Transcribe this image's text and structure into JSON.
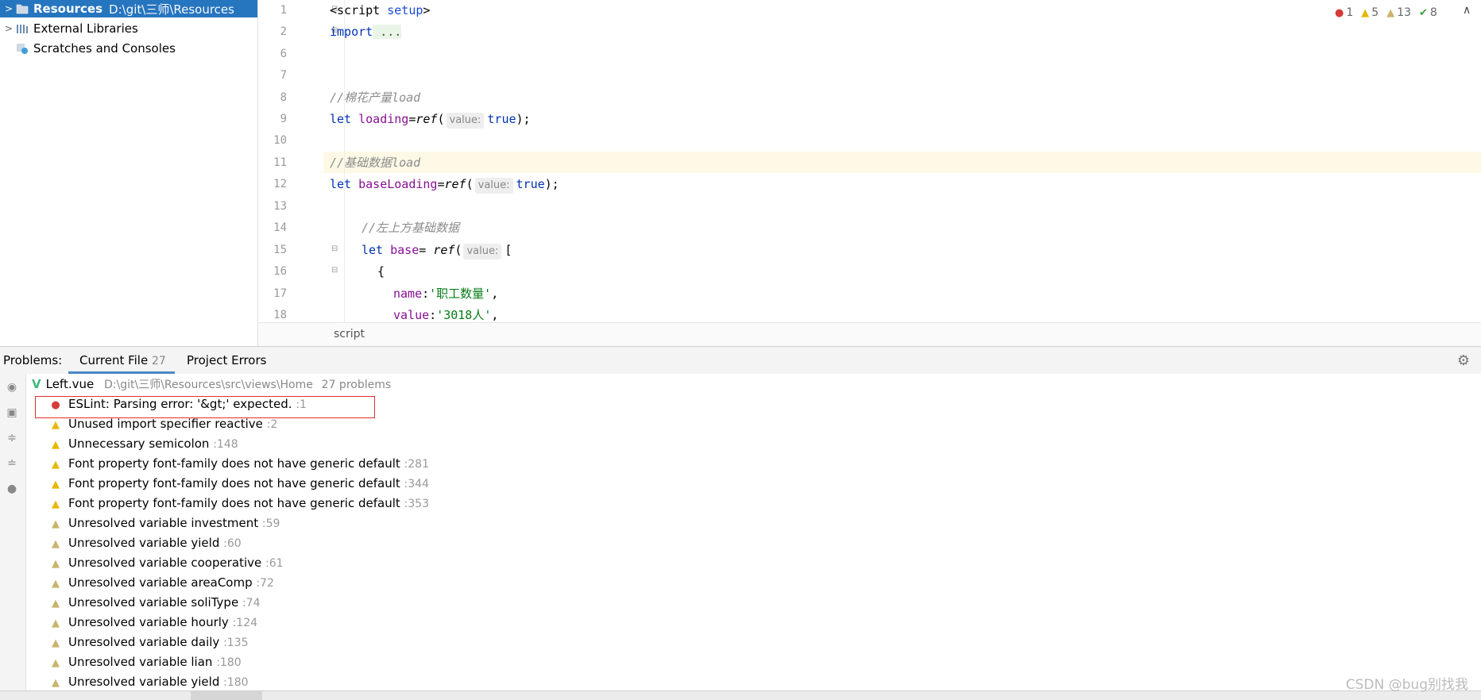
{
  "tree": {
    "items": [
      {
        "arrow": ">",
        "name": "Resources",
        "path": "D:\\git\\三师\\Resources",
        "selected": true
      },
      {
        "arrow": ">",
        "name": "External Libraries",
        "path": "",
        "selected": false
      },
      {
        "arrow": "",
        "name": "Scratches and Consoles",
        "path": "",
        "selected": false
      }
    ]
  },
  "editor": {
    "line_numbers": [
      "1",
      "2",
      "6",
      "7",
      "8",
      "9",
      "10",
      "11",
      "12",
      "13",
      "14",
      "15",
      "16",
      "17",
      "18"
    ],
    "inspections": {
      "errors": "1",
      "warnings": "5",
      "weak_warnings": "13",
      "typos": "8"
    },
    "breadcrumb": "script",
    "hint_label": "value:"
  },
  "problems": {
    "label": "Problems:",
    "tabs": [
      {
        "label": "Current File",
        "count": "27"
      },
      {
        "label": "Project Errors",
        "count": ""
      }
    ],
    "file": {
      "name": "Left.vue",
      "path": "D:\\git\\三师\\Resources\\src\\views\\Home",
      "count": "27 problems"
    },
    "items": [
      {
        "severity": "error",
        "text": "ESLint: Parsing error: '&gt;' expected.",
        "line": ":1"
      },
      {
        "severity": "warning",
        "text": "Unused import specifier reactive",
        "line": ":2"
      },
      {
        "severity": "warning",
        "text": "Unnecessary semicolon",
        "line": ":148"
      },
      {
        "severity": "warning",
        "text": "Font property font-family does not have generic default",
        "line": ":281"
      },
      {
        "severity": "warning",
        "text": "Font property font-family does not have generic default",
        "line": ":344"
      },
      {
        "severity": "warning",
        "text": "Font property font-family does not have generic default",
        "line": ":353"
      },
      {
        "severity": "weak",
        "text": "Unresolved variable investment",
        "line": ":59"
      },
      {
        "severity": "weak",
        "text": "Unresolved variable yield",
        "line": ":60"
      },
      {
        "severity": "weak",
        "text": "Unresolved variable cooperative",
        "line": ":61"
      },
      {
        "severity": "weak",
        "text": "Unresolved variable areaComp",
        "line": ":72"
      },
      {
        "severity": "weak",
        "text": "Unresolved variable soliType",
        "line": ":74"
      },
      {
        "severity": "weak",
        "text": "Unresolved variable hourly",
        "line": ":124"
      },
      {
        "severity": "weak",
        "text": "Unresolved variable daily",
        "line": ":135"
      },
      {
        "severity": "weak",
        "text": "Unresolved variable lian",
        "line": ":180"
      },
      {
        "severity": "weak",
        "text": "Unresolved variable yield",
        "line": ":180"
      }
    ]
  },
  "code": {
    "l1_tag_open": "<script",
    "l1_setup": " setup",
    "l1_tag_close": ">",
    "l2_kw": "import",
    "l2_rest": " ...",
    "l8_comment": "//棉花产量load",
    "l9_kw": "let",
    "l9_var": " loading",
    "l9_eq": "=",
    "l9_fn": "ref",
    "l9_paren": "(",
    "l9_val": "true",
    "l9_end": ");",
    "l11_comment": "//基础数据load",
    "l12_kw": "let",
    "l12_var": " baseLoading",
    "l12_eq": "=",
    "l12_fn": "ref",
    "l12_paren": "(",
    "l12_val": "true",
    "l12_end": ");",
    "l14_comment": "//左上方基础数据",
    "l15_kw": "let",
    "l15_var": " base",
    "l15_eq": "= ",
    "l15_fn": "ref",
    "l15_paren": "(",
    "l15_bracket": "[",
    "l16_brace": "{",
    "l17_key": "name",
    "l17_colon": ":",
    "l17_str": "'职工数量'",
    "l17_comma": ",",
    "l18_key": "value",
    "l18_colon": ":",
    "l18_str": "'3018人'",
    "l18_comma": ","
  },
  "watermark": "CSDN @bug别找我",
  "colors": {
    "selection": "#2675bf",
    "error": "#d63b3b",
    "warning": "#e6b800",
    "highlight": "#fdf9e6"
  }
}
